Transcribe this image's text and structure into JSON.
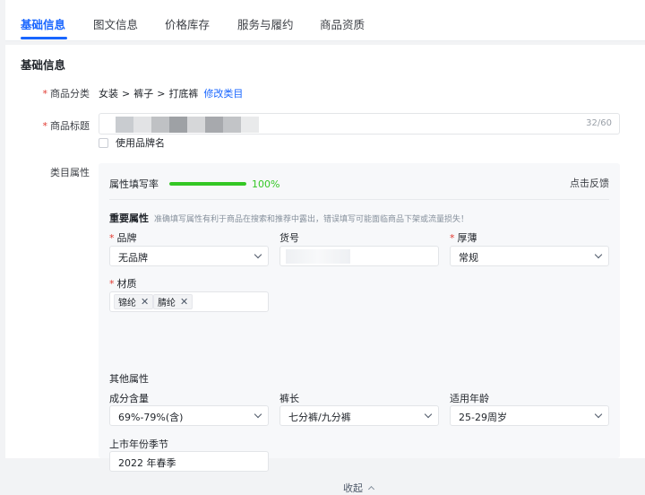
{
  "tabs": [
    {
      "label": "基础信息"
    },
    {
      "label": "图文信息"
    },
    {
      "label": "价格库存"
    },
    {
      "label": "服务与履约"
    },
    {
      "label": "商品资质"
    }
  ],
  "section_title": "基础信息",
  "category": {
    "label": "商品分类",
    "path": [
      "女装",
      "裤子",
      "打底裤"
    ],
    "separator": ">",
    "edit_label": "修改类目"
  },
  "product_title": {
    "label": "商品标题",
    "counter": "32/60",
    "use_brand_label": "使用品牌名"
  },
  "attributes": {
    "label": "类目属性",
    "fill_rate_label": "属性填写率",
    "fill_rate_percent": 100,
    "fill_rate_text": "100%",
    "feedback_label": "点击反馈",
    "important_title": "重要属性",
    "important_hint": "准确填写属性有利于商品在搜索和推荐中露出，错误填写可能面临商品下架或流量损失！",
    "brand": {
      "label": "品牌",
      "value": "无品牌"
    },
    "sku": {
      "label": "货号"
    },
    "thickness": {
      "label": "厚薄",
      "value": "常规"
    },
    "material": {
      "label": "材质",
      "tags": [
        "锦纶",
        "腈纶"
      ]
    },
    "other_title": "其他属性",
    "composition": {
      "label": "成分含量",
      "value": "69%-79%(含)"
    },
    "length": {
      "label": "裤长",
      "value": "七分裤/九分裤"
    },
    "age": {
      "label": "适用年龄",
      "value": "25-29周岁"
    },
    "season": {
      "label": "上市年份季节",
      "value": "2022 年春季"
    },
    "collapse_label": "收起"
  },
  "colors": {
    "accent": "#1966ff",
    "required": "#e0382f",
    "progress": "#34c724"
  }
}
